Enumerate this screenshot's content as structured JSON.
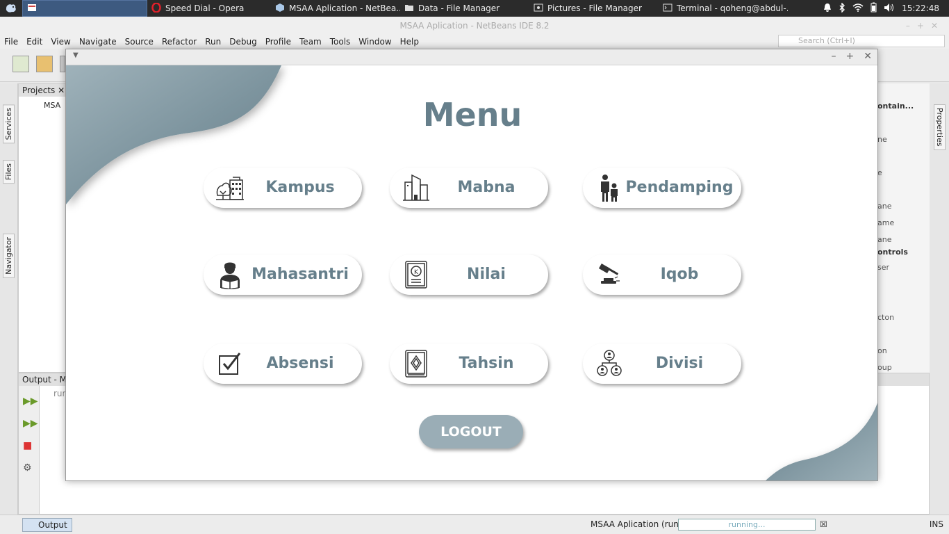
{
  "taskbar": {
    "items": [
      {
        "label": "Speed Dial - Opera"
      },
      {
        "label": "MSAA Aplication - NetBea..."
      },
      {
        "label": "Data - File Manager"
      },
      {
        "label": "Pictures - File Manager"
      },
      {
        "label": "Terminal - qoheng@abdul-..."
      }
    ],
    "clock": "15:22:48"
  },
  "ide": {
    "title": "MSAA Aplication - NetBeans IDE 8.2",
    "menu": [
      "File",
      "Edit",
      "View",
      "Navigate",
      "Source",
      "Refactor",
      "Run",
      "Debug",
      "Profile",
      "Team",
      "Tools",
      "Window",
      "Help"
    ],
    "search_placeholder": "Search (Ctrl+I)",
    "left_tabs": [
      "Services",
      "Files",
      "Navigator"
    ],
    "projects_tab": "Projects",
    "project_root": "MSA",
    "right_panel_items": [
      "ontain...",
      "ne",
      "e",
      "ane",
      "ame",
      "ane",
      "ontrols",
      "ser",
      "cton",
      "on",
      "oup"
    ],
    "right_tab": "Properties",
    "output_tab": "Output - M",
    "output_text": "run",
    "status": {
      "output_button": "Output",
      "run_label": "MSAA Aplication (run)",
      "progress_text": "running...",
      "mode": "INS"
    }
  },
  "app": {
    "title": "Menu",
    "cards": [
      {
        "label": "Kampus",
        "icon": "campus-icon"
      },
      {
        "label": "Mabna",
        "icon": "building-icon"
      },
      {
        "label": "Pendamping",
        "icon": "parent-child-icon"
      },
      {
        "label": "Mahasantri",
        "icon": "student-reading-icon"
      },
      {
        "label": "Nilai",
        "icon": "grade-book-icon"
      },
      {
        "label": "Iqob",
        "icon": "gavel-icon"
      },
      {
        "label": "Absensi",
        "icon": "checkbox-icon"
      },
      {
        "label": "Tahsin",
        "icon": "quran-icon"
      },
      {
        "label": "Divisi",
        "icon": "org-chart-icon"
      }
    ],
    "logout_label": "LOGOUT"
  },
  "colors": {
    "accent": "#667f8b",
    "logout_bg": "#9aadb6",
    "taskbar_bg": "#2b2b2b",
    "taskbar_active": "#3d5a80"
  }
}
